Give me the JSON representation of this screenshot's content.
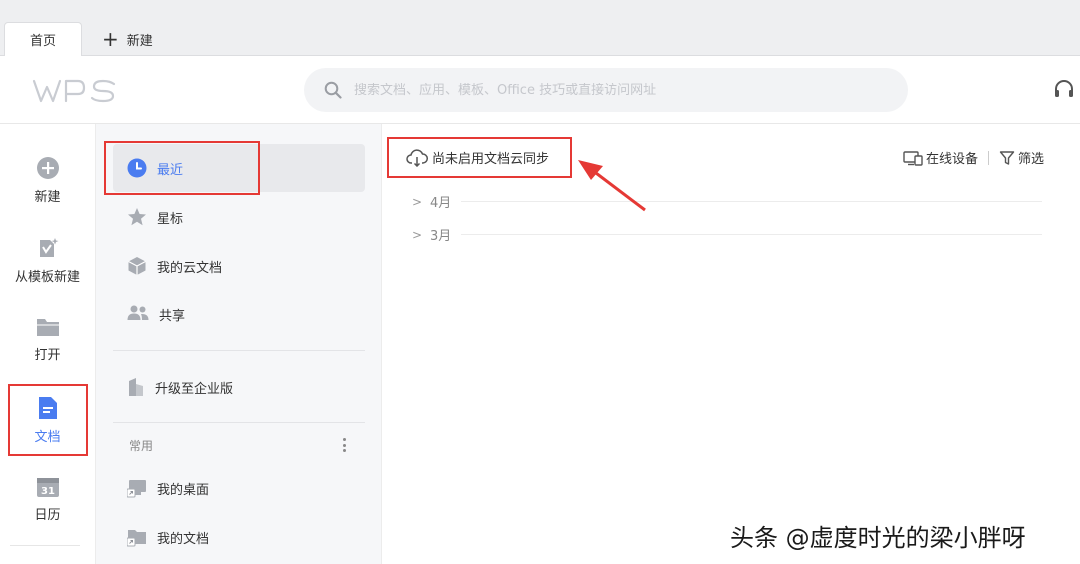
{
  "tabs": [
    {
      "label": "首页"
    },
    {
      "label": "新建"
    }
  ],
  "header": {
    "search_placeholder": "搜索文档、应用、模板、Office 技巧或直接访问网址"
  },
  "rail": {
    "items": [
      {
        "label": "新建",
        "icon": "plus-circle-icon"
      },
      {
        "label": "从模板新建",
        "icon": "template-icon"
      },
      {
        "label": "打开",
        "icon": "folder-icon"
      },
      {
        "label": "文档",
        "icon": "document-icon"
      },
      {
        "label": "日历",
        "icon": "calendar-icon"
      }
    ]
  },
  "nav": {
    "items": [
      {
        "label": "最近",
        "icon": "clock-icon"
      },
      {
        "label": "星标",
        "icon": "star-icon"
      },
      {
        "label": "我的云文档",
        "icon": "cloud-box-icon"
      },
      {
        "label": "共享",
        "icon": "people-icon"
      },
      {
        "label": "升级至企业版",
        "icon": "building-icon"
      }
    ],
    "group_title": "常用",
    "common": [
      {
        "label": "我的桌面",
        "icon": "desktop-shortcut-icon"
      },
      {
        "label": "我的文档",
        "icon": "folder-shortcut-icon"
      }
    ]
  },
  "main": {
    "sync_label": "尚未启用文档云同步",
    "online_devices": "在线设备",
    "filter": "筛选",
    "months": [
      "4月",
      "3月"
    ]
  },
  "watermark": "头条 @虚度时光的梁小胖呀",
  "colors": {
    "accent": "#4a7cf0",
    "annotation_red": "#e53935",
    "icon_gray": "#a8acb3"
  }
}
